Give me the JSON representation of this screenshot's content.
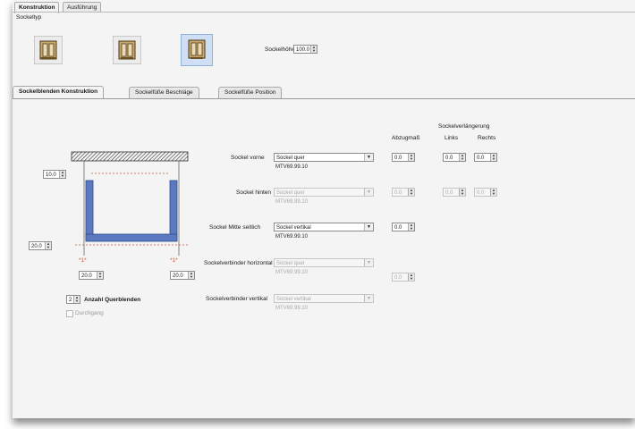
{
  "tabs_top": [
    {
      "label": "Konstruktion",
      "active": true
    },
    {
      "label": "Ausführung",
      "active": false
    }
  ],
  "top_panel": {
    "group_label": "Sockeltyp",
    "sockel_types": [
      {
        "icon": "cabinet-icon-type-1",
        "selected": false
      },
      {
        "icon": "cabinet-icon-type-2",
        "selected": false
      },
      {
        "icon": "cabinet-icon-type-3",
        "selected": true
      }
    ],
    "sockelhoehe_label": "Sockelhöhe",
    "sockelhoehe_value": "100.0"
  },
  "tabs_section": [
    {
      "label": "Sockelblenden Konstruktion",
      "active": true
    },
    {
      "label": "Sockelfüße Beschläge",
      "active": false
    },
    {
      "label": "Sockelfüße Position",
      "active": false
    }
  ],
  "headers": {
    "abzugsmass": "Abzugmaß",
    "verlaengerung": "Sockelverlängerung",
    "links": "Links",
    "rechts": "Rechts"
  },
  "diagram": {
    "top_offset": "10.0",
    "bottom_offset": "20.0",
    "left_foot": "20.0",
    "right_foot": "20.0",
    "marker_left": "*1*",
    "marker_right": "*1*",
    "anzahl_value": "2",
    "anzahl_label": "Anzahl Querblenden",
    "durchgang_label": "Durchgang"
  },
  "rows": [
    {
      "label": "Sockel vorne",
      "select": "Sockel quer",
      "code": "MTV69.99.10",
      "abzug": "0.0",
      "links": "0.0",
      "rechts": "0.0",
      "enabled": true
    },
    {
      "label": "Sockel hinten",
      "select": "Sockel quer",
      "code": "MTV69.99.10",
      "abzug": "0.0",
      "links": "0.0",
      "rechts": "0.0",
      "enabled": false
    },
    {
      "label": "Sockel Mitte seitlich",
      "select": "Sockel vertikal",
      "code": "MTV69.99.10",
      "abzug": "0.0",
      "enabled": true
    },
    {
      "label": "Sockelverbinder horizontal",
      "select": "Sockel quer",
      "code": "MTV69.99.10",
      "abzug": "0.0",
      "enabled": false
    },
    {
      "label": "Sockelverbinder vertikal",
      "select": "Sockel vertikal",
      "code": "MTV69.99.10",
      "enabled": false
    }
  ]
}
